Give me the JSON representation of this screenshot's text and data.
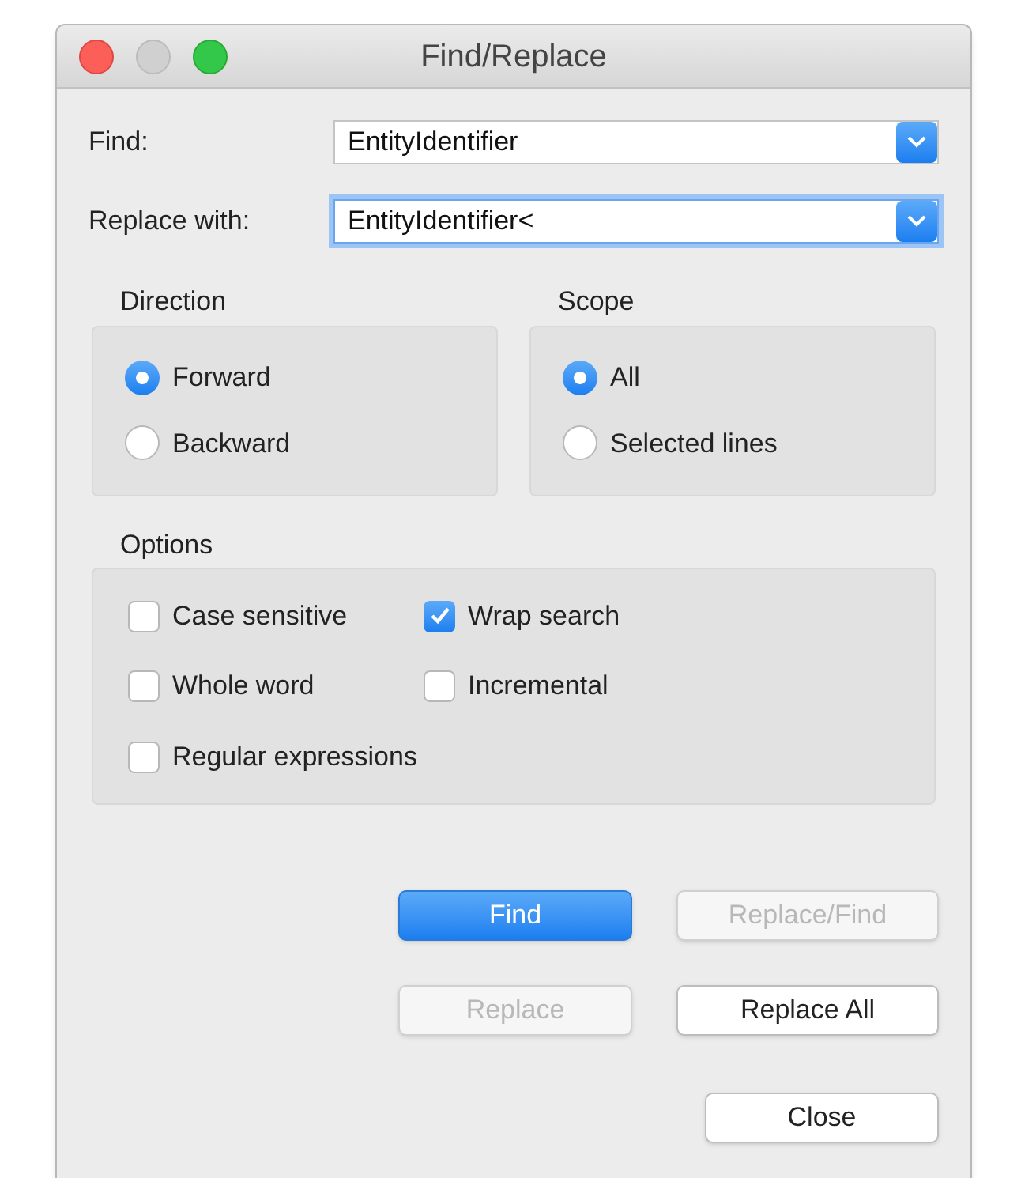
{
  "window": {
    "title": "Find/Replace"
  },
  "fields": [
    {
      "label": "Find:",
      "value": "EntityIdentifier",
      "focused": false
    },
    {
      "label": "Replace with:",
      "value": "EntityIdentifier<",
      "focused": true
    }
  ],
  "groups": [
    {
      "title": "Direction",
      "options": [
        {
          "label": "Forward",
          "selected": true
        },
        {
          "label": "Backward",
          "selected": false
        }
      ]
    },
    {
      "title": "Scope",
      "options": [
        {
          "label": "All",
          "selected": true
        },
        {
          "label": "Selected lines",
          "selected": false
        }
      ]
    }
  ],
  "options": {
    "title": "Options",
    "items": [
      {
        "label": "Case sensitive",
        "checked": false
      },
      {
        "label": "Wrap search",
        "checked": true
      },
      {
        "label": "Whole word",
        "checked": false
      },
      {
        "label": "Incremental",
        "checked": false
      },
      {
        "label": "Regular expressions",
        "checked": false
      }
    ]
  },
  "button_rows": [
    [
      {
        "label": "Find",
        "kind": "primary",
        "disabled": false
      },
      {
        "label": "Replace/Find",
        "kind": "normal",
        "disabled": true
      }
    ],
    [
      {
        "label": "Replace",
        "kind": "normal",
        "disabled": true
      },
      {
        "label": "Replace All",
        "kind": "normal",
        "disabled": false
      }
    ],
    [
      {
        "label": "Close",
        "kind": "normal",
        "disabled": false
      }
    ]
  ]
}
